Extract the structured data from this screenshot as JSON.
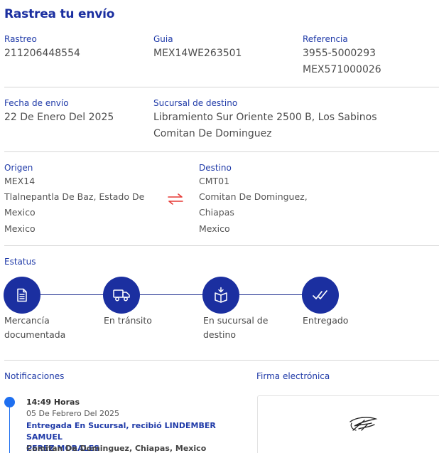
{
  "header": {
    "title": "Rastrea tu envío"
  },
  "shipment": {
    "tracking_label": "Rastreo",
    "tracking_value": "211206448554",
    "guide_label": "Guia",
    "guide_value": "MEX14WE263501",
    "reference_label": "Referencia",
    "reference_values": [
      "3955-5000293",
      "MEX571000026"
    ],
    "ship_date_label": "Fecha de envío",
    "ship_date_value": "22 De Enero Del 2025",
    "dest_branch_label": "Sucursal de destino",
    "dest_branch_lines": [
      "Libramiento Sur Oriente 2500 B, Los Sabinos",
      "Comitan De Dominguez"
    ]
  },
  "origin": {
    "label": "Origen",
    "code": "MEX14",
    "lines": [
      "Tlalnepantla De Baz, Estado De",
      "Mexico",
      "Mexico"
    ]
  },
  "destination": {
    "label": "Destino",
    "code": "CMT01",
    "lines": [
      "Comitan De Dominguez,",
      "Chiapas",
      "Mexico"
    ]
  },
  "swap_icon": {
    "name": "swap-arrows-icon",
    "color": "#e53935"
  },
  "status": {
    "label": "Estatus",
    "steps": [
      {
        "icon": "document-icon",
        "lines": [
          "Mercancía",
          "documentada"
        ]
      },
      {
        "icon": "truck-icon",
        "lines": [
          "En tránsito"
        ]
      },
      {
        "icon": "package-icon",
        "lines": [
          "En sucursal de",
          "destino"
        ]
      },
      {
        "icon": "double-check-icon",
        "lines": [
          "Entregado"
        ]
      }
    ]
  },
  "notifications": {
    "label": "Notificaciones",
    "items": [
      {
        "time": "14:49 Horas",
        "date": "05 De Febrero Del 2025",
        "status_lines": [
          "Entregada En Sucursal, recibió LINDEMBER SAMUEL",
          "PEREZ MORALES"
        ],
        "location": "Comitan De Dominguez, Chiapas, Mexico"
      }
    ]
  },
  "signature": {
    "label": "Firma electrónica"
  },
  "colors": {
    "primary": "#1b2fa0",
    "accent_blue": "#1e6ff0",
    "swap_red": "#e53935"
  }
}
